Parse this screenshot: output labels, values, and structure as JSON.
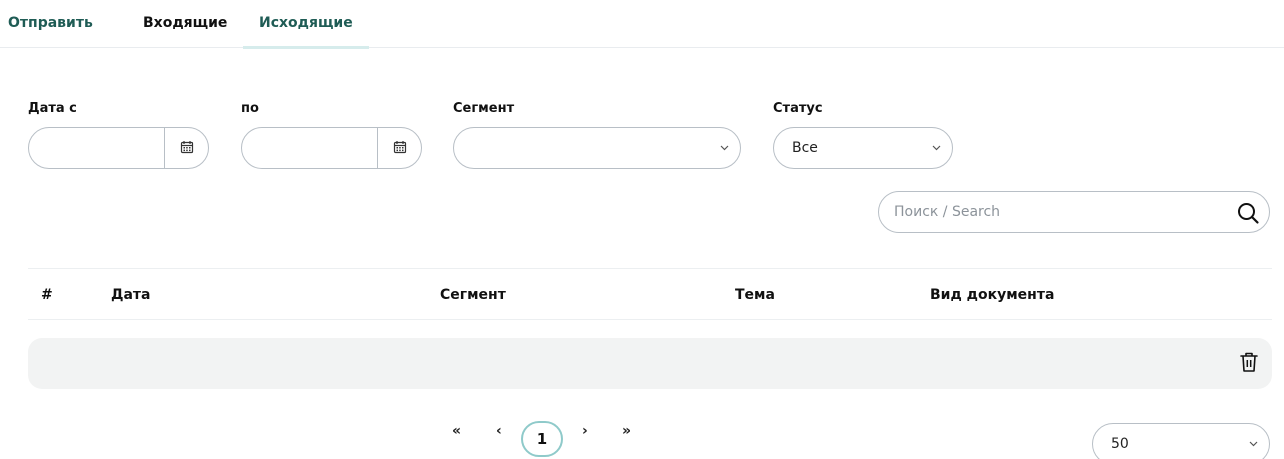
{
  "tabs": [
    {
      "label": "Отправить"
    },
    {
      "label": "Входящие"
    },
    {
      "label": "Исходящие"
    }
  ],
  "active_tab": "Исходящие",
  "filters": {
    "date_from_label": "Дата с",
    "date_to_label": "по",
    "segment_label": "Сегмент",
    "status_label": "Статус",
    "date_from_value": "",
    "date_to_value": "",
    "segment_value": "",
    "status_value": "Все"
  },
  "search": {
    "placeholder": "Поиск / Search",
    "value": ""
  },
  "table": {
    "columns": [
      "#",
      "Дата",
      "Сегмент",
      "Тема",
      "Вид документа"
    ],
    "rows": [
      {
        "cells": [
          "",
          "",
          "",
          "",
          ""
        ]
      }
    ]
  },
  "pagination": {
    "first": "«",
    "prev": "‹",
    "current": "1",
    "next": "›",
    "last": "»",
    "page_size": "50"
  },
  "colors": {
    "accent": "#1f5c55",
    "active_tab_underline": "#d6ecec",
    "page_highlight": "#8fcaca",
    "row_background": "#f2f3f3",
    "border": "#b8bfc6"
  }
}
